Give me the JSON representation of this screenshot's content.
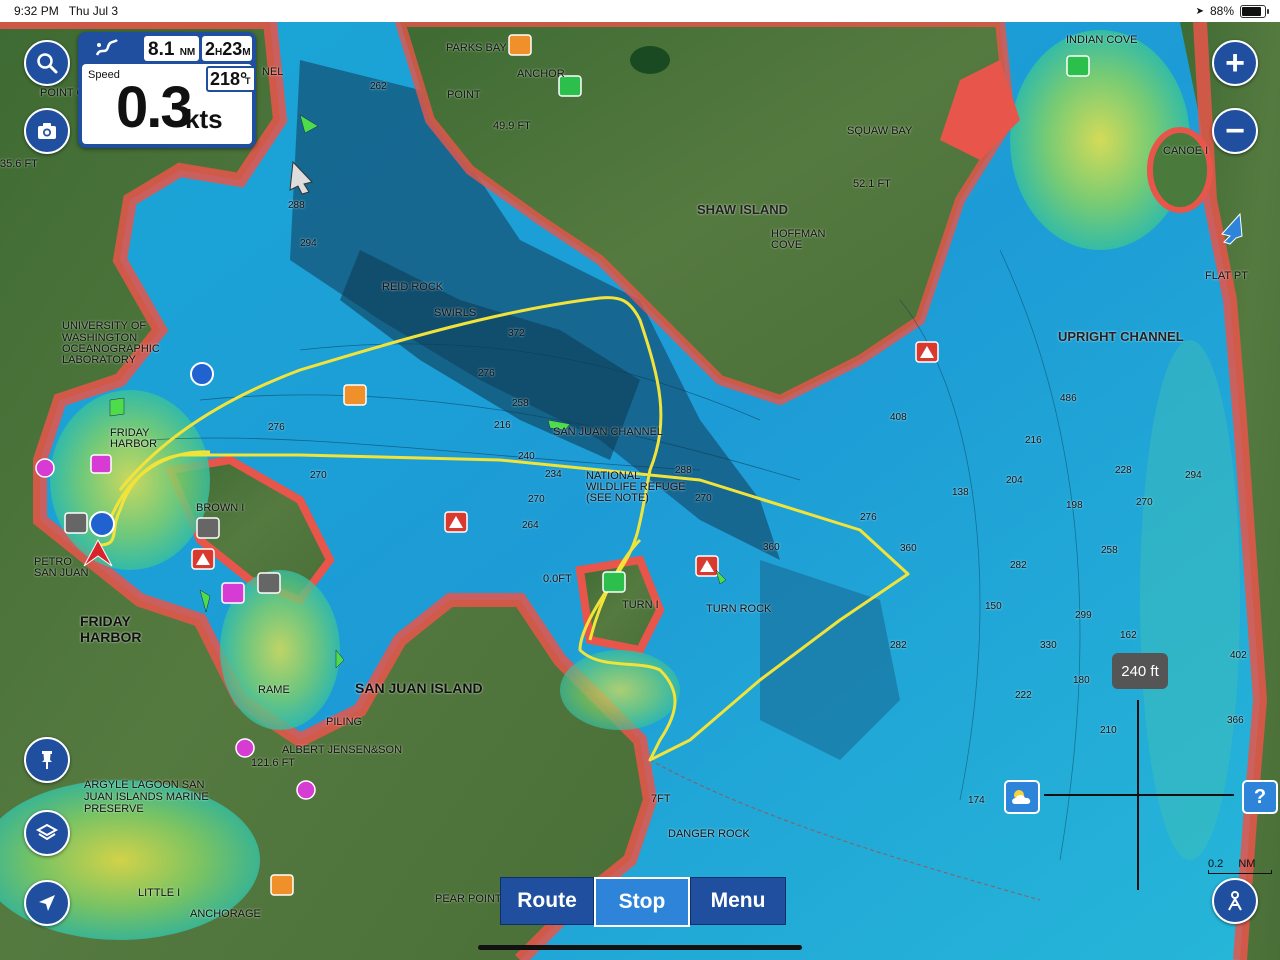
{
  "status_bar": {
    "time": "9:32 PM",
    "date": "Thu Jul 3",
    "battery": "88%"
  },
  "dashboard": {
    "distance_value": "8.1",
    "distance_unit": "NM",
    "time_hours": "2",
    "time_h_unit": "H",
    "time_minutes": "23",
    "time_m_unit": "M",
    "speed_label": "Speed",
    "speed_value": "0.3",
    "speed_unit": "kts",
    "heading": "218°",
    "heading_ref": "T"
  },
  "buttons": {
    "search_icon": "search-icon",
    "camera_icon": "camera-icon",
    "zoom_in": "+",
    "zoom_out": "−",
    "pin_icon": "pin-icon",
    "layers_icon": "layers-icon",
    "locate_icon": "navigation-arrow-icon",
    "person_icon": "person-icon",
    "weather_icon": "weather-icon",
    "help": "?"
  },
  "bottom_bar": {
    "route": "Route",
    "stop": "Stop",
    "menu": "Menu"
  },
  "scale": {
    "pill": "240 ft",
    "bar_value": "0.2",
    "bar_unit": "NM"
  },
  "map_labels": {
    "point_caution": "POINT CAUTIO",
    "university": "UNIVERSITY OF",
    "washington": "WASHINGTON",
    "oceanographic": "OCEANOGRAPHIC",
    "laboratory": "LABORATORY",
    "friday_harbor_small": "FRIDAY",
    "harbor_small": "HARBOR",
    "brown_i": "BROWN I",
    "petro": "PETRO",
    "san_juan_small": "SAN JUAN",
    "friday_harbor_big1": "FRIDAY",
    "friday_harbor_big2": "HARBOR",
    "san_juan_island": "SAN JUAN ISLAND",
    "argyle1": "ARGYLE LAGOON SAN",
    "argyle2": "JUAN ISLANDS MARINE",
    "argyle3": "PRESERVE",
    "shaw_island": "SHAW ISLAND",
    "hoffman_cove1": "HOFFMAN",
    "hoffman_cove2": "COVE",
    "squaw_bay": "SQUAW BAY",
    "indian_cove": "INDIAN COVE",
    "canoe_i": "CANOE I",
    "flat_pt": "FLAT PT",
    "upright_channel": "UPRIGHT CHANNEL",
    "parks_bay": "PARKS BAY",
    "anchorage_top": "ANCHOR",
    "point_top": "POINT",
    "reid_rock": "REID ROCK",
    "swirls": "SWIRLS",
    "san_juan_channel": "SAN JUAN CHANNEL",
    "nwr1": "NATIONAL",
    "nwr2": "WILDLIFE REFUGE",
    "nwr3": "(SEE NOTE)",
    "turn_i": "TURN I",
    "turn_rock": "TURN ROCK",
    "danger_rock": "DANGER ROCK",
    "pear_point": "PEAR POINT",
    "little_i": "LITTLE I",
    "anchorage_bottom": "ANCHORAGE",
    "albert": "ALBERT JENSEN&SON",
    "piling": "PILING",
    "rame": "RAME",
    "channel_top": "NEL",
    "ft1": "49.9 FT",
    "ft2": "52.1 FT",
    "ft3": "121.6 FT",
    "ft4": "35.6 FT",
    "ft5": "0.0FT",
    "ft6": "7FT",
    "depths": [
      "372",
      "276",
      "258",
      "216",
      "240",
      "234",
      "270",
      "264",
      "288",
      "276",
      "282",
      "294",
      "299",
      "210",
      "222",
      "174",
      "204",
      "216",
      "228",
      "258",
      "270",
      "150",
      "138",
      "198",
      "162",
      "180",
      "330",
      "402",
      "366",
      "486",
      "408",
      "360",
      "270",
      "360",
      "262",
      "288",
      "294",
      "276",
      "270",
      "282"
    ]
  },
  "colors": {
    "ui_blue": "#1f4f9e",
    "active_blue": "#2d84d8",
    "track": "#f2e33a"
  }
}
